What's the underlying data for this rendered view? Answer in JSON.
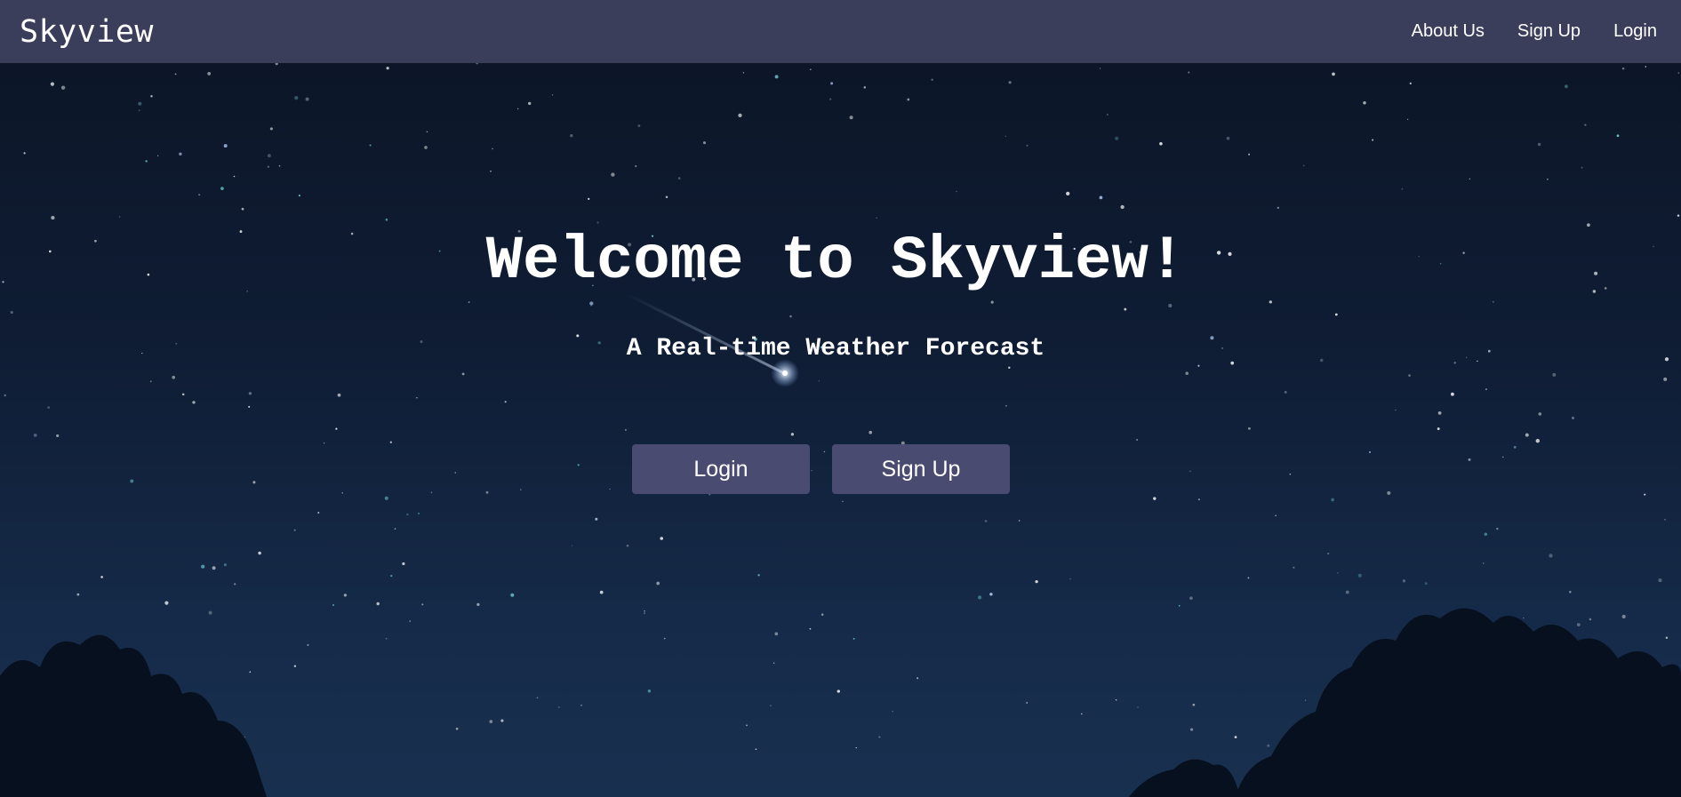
{
  "nav": {
    "brand": "Skyview",
    "links": [
      "About Us",
      "Sign Up",
      "Login"
    ]
  },
  "hero": {
    "title": "Welcome to Skyview!",
    "subtitle": "A Real-time Weather Forecast",
    "buttons": [
      "Login",
      "Sign Up"
    ]
  },
  "colors": {
    "navbar": "#3b3e5b",
    "button": "#4a4b70",
    "sky": "#0f1d35",
    "text": "#ffffff"
  }
}
